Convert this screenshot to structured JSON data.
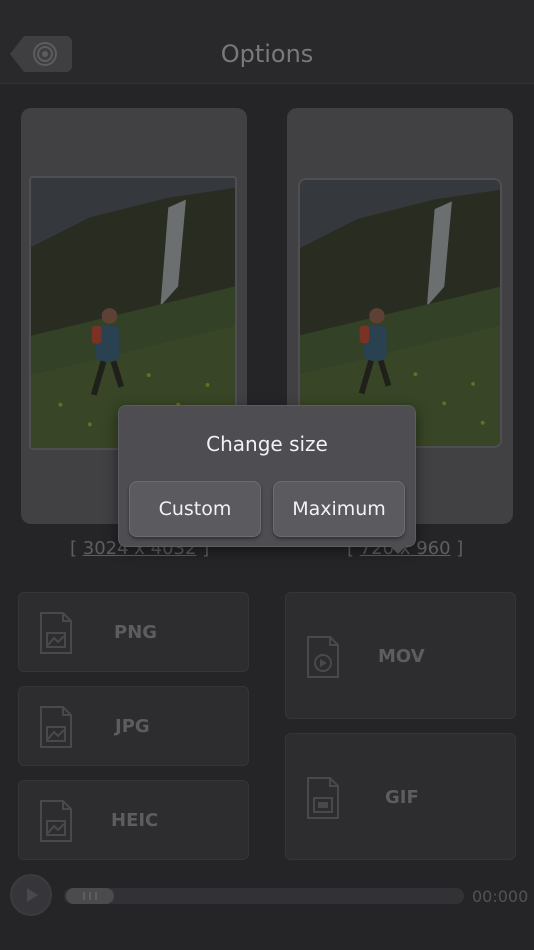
{
  "header": {
    "title": "Options",
    "back_icon": "target-icon"
  },
  "previews": [
    {
      "dimensions": "3024 x 4032"
    },
    {
      "dimensions": "720 x 960"
    }
  ],
  "formats": {
    "png": {
      "label": "PNG",
      "icon": "image-file-icon"
    },
    "jpg": {
      "label": "JPG",
      "icon": "image-file-icon"
    },
    "heic": {
      "label": "HEIC",
      "icon": "image-file-icon"
    },
    "mov": {
      "label": "MOV",
      "icon": "video-file-icon"
    },
    "gif": {
      "label": "GIF",
      "icon": "gif-file-icon"
    }
  },
  "player": {
    "time": "00:000",
    "progress": 0.04
  },
  "dialog": {
    "title": "Change size",
    "custom_label": "Custom",
    "maximum_label": "Maximum"
  },
  "colors": {
    "background": "#2b2b2e",
    "card": "#4a4a4e",
    "dialog": "#4d4d52",
    "dialog_button": "#5a5a5f"
  }
}
